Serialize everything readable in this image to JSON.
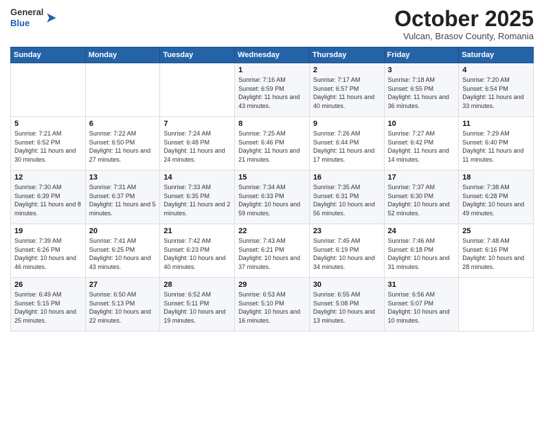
{
  "logo": {
    "general": "General",
    "blue": "Blue"
  },
  "header": {
    "month": "October 2025",
    "location": "Vulcan, Brasov County, Romania"
  },
  "days_of_week": [
    "Sunday",
    "Monday",
    "Tuesday",
    "Wednesday",
    "Thursday",
    "Friday",
    "Saturday"
  ],
  "weeks": [
    [
      {
        "num": "",
        "info": ""
      },
      {
        "num": "",
        "info": ""
      },
      {
        "num": "",
        "info": ""
      },
      {
        "num": "1",
        "info": "Sunrise: 7:16 AM\nSunset: 6:59 PM\nDaylight: 11 hours and 43 minutes."
      },
      {
        "num": "2",
        "info": "Sunrise: 7:17 AM\nSunset: 6:57 PM\nDaylight: 11 hours and 40 minutes."
      },
      {
        "num": "3",
        "info": "Sunrise: 7:18 AM\nSunset: 6:55 PM\nDaylight: 11 hours and 36 minutes."
      },
      {
        "num": "4",
        "info": "Sunrise: 7:20 AM\nSunset: 6:54 PM\nDaylight: 11 hours and 33 minutes."
      }
    ],
    [
      {
        "num": "5",
        "info": "Sunrise: 7:21 AM\nSunset: 6:52 PM\nDaylight: 11 hours and 30 minutes."
      },
      {
        "num": "6",
        "info": "Sunrise: 7:22 AM\nSunset: 6:50 PM\nDaylight: 11 hours and 27 minutes."
      },
      {
        "num": "7",
        "info": "Sunrise: 7:24 AM\nSunset: 6:48 PM\nDaylight: 11 hours and 24 minutes."
      },
      {
        "num": "8",
        "info": "Sunrise: 7:25 AM\nSunset: 6:46 PM\nDaylight: 11 hours and 21 minutes."
      },
      {
        "num": "9",
        "info": "Sunrise: 7:26 AM\nSunset: 6:44 PM\nDaylight: 11 hours and 17 minutes."
      },
      {
        "num": "10",
        "info": "Sunrise: 7:27 AM\nSunset: 6:42 PM\nDaylight: 11 hours and 14 minutes."
      },
      {
        "num": "11",
        "info": "Sunrise: 7:29 AM\nSunset: 6:40 PM\nDaylight: 11 hours and 11 minutes."
      }
    ],
    [
      {
        "num": "12",
        "info": "Sunrise: 7:30 AM\nSunset: 6:39 PM\nDaylight: 11 hours and 8 minutes."
      },
      {
        "num": "13",
        "info": "Sunrise: 7:31 AM\nSunset: 6:37 PM\nDaylight: 11 hours and 5 minutes."
      },
      {
        "num": "14",
        "info": "Sunrise: 7:33 AM\nSunset: 6:35 PM\nDaylight: 11 hours and 2 minutes."
      },
      {
        "num": "15",
        "info": "Sunrise: 7:34 AM\nSunset: 6:33 PM\nDaylight: 10 hours and 59 minutes."
      },
      {
        "num": "16",
        "info": "Sunrise: 7:35 AM\nSunset: 6:31 PM\nDaylight: 10 hours and 56 minutes."
      },
      {
        "num": "17",
        "info": "Sunrise: 7:37 AM\nSunset: 6:30 PM\nDaylight: 10 hours and 52 minutes."
      },
      {
        "num": "18",
        "info": "Sunrise: 7:38 AM\nSunset: 6:28 PM\nDaylight: 10 hours and 49 minutes."
      }
    ],
    [
      {
        "num": "19",
        "info": "Sunrise: 7:39 AM\nSunset: 6:26 PM\nDaylight: 10 hours and 46 minutes."
      },
      {
        "num": "20",
        "info": "Sunrise: 7:41 AM\nSunset: 6:25 PM\nDaylight: 10 hours and 43 minutes."
      },
      {
        "num": "21",
        "info": "Sunrise: 7:42 AM\nSunset: 6:23 PM\nDaylight: 10 hours and 40 minutes."
      },
      {
        "num": "22",
        "info": "Sunrise: 7:43 AM\nSunset: 6:21 PM\nDaylight: 10 hours and 37 minutes."
      },
      {
        "num": "23",
        "info": "Sunrise: 7:45 AM\nSunset: 6:19 PM\nDaylight: 10 hours and 34 minutes."
      },
      {
        "num": "24",
        "info": "Sunrise: 7:46 AM\nSunset: 6:18 PM\nDaylight: 10 hours and 31 minutes."
      },
      {
        "num": "25",
        "info": "Sunrise: 7:48 AM\nSunset: 6:16 PM\nDaylight: 10 hours and 28 minutes."
      }
    ],
    [
      {
        "num": "26",
        "info": "Sunrise: 6:49 AM\nSunset: 5:15 PM\nDaylight: 10 hours and 25 minutes."
      },
      {
        "num": "27",
        "info": "Sunrise: 6:50 AM\nSunset: 5:13 PM\nDaylight: 10 hours and 22 minutes."
      },
      {
        "num": "28",
        "info": "Sunrise: 6:52 AM\nSunset: 5:11 PM\nDaylight: 10 hours and 19 minutes."
      },
      {
        "num": "29",
        "info": "Sunrise: 6:53 AM\nSunset: 5:10 PM\nDaylight: 10 hours and 16 minutes."
      },
      {
        "num": "30",
        "info": "Sunrise: 6:55 AM\nSunset: 5:08 PM\nDaylight: 10 hours and 13 minutes."
      },
      {
        "num": "31",
        "info": "Sunrise: 6:56 AM\nSunset: 5:07 PM\nDaylight: 10 hours and 10 minutes."
      },
      {
        "num": "",
        "info": ""
      }
    ]
  ]
}
